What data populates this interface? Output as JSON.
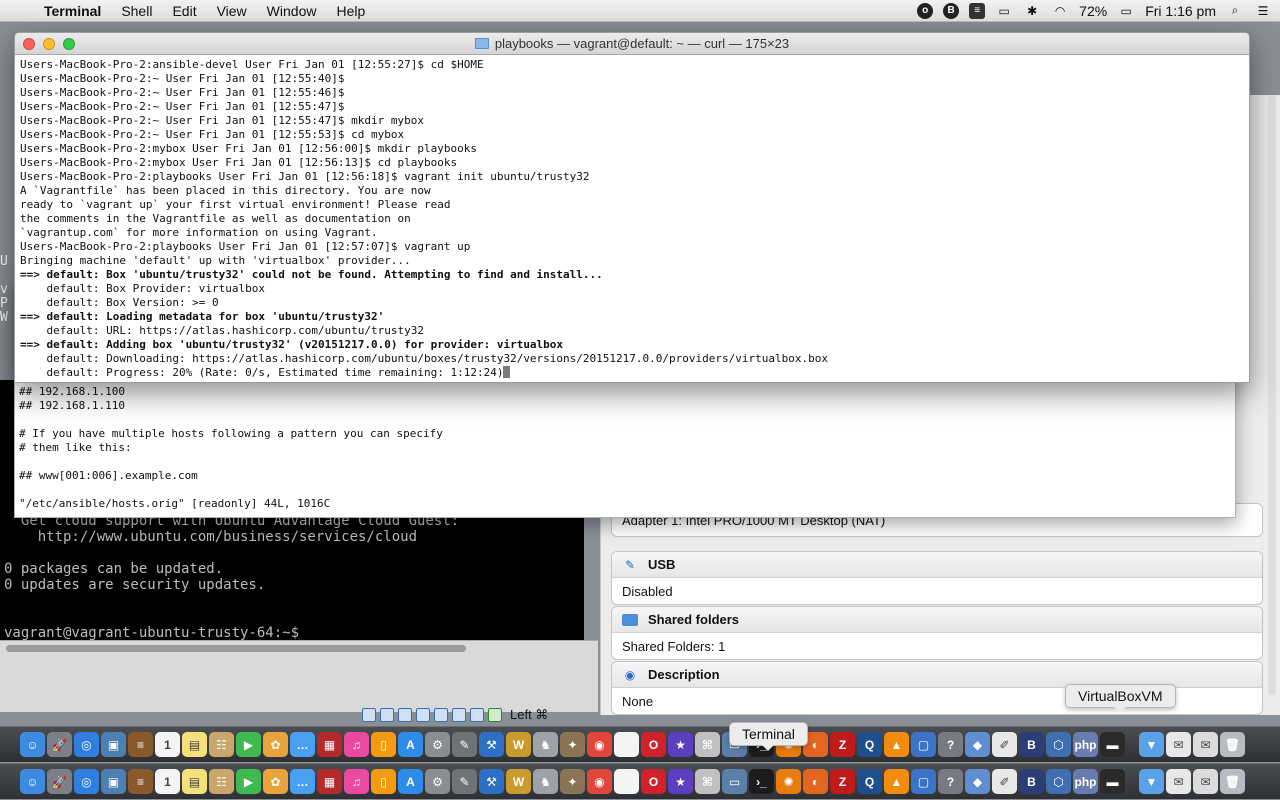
{
  "menubar": {
    "app_name": "Terminal",
    "menus": [
      "Shell",
      "Edit",
      "View",
      "Window",
      "Help"
    ],
    "battery": "72%",
    "clock": "Fri 1:16 pm"
  },
  "terminal": {
    "title": "playbooks — vagrant@default: ~ — curl — 175×23",
    "lines": [
      {
        "text": "Users-MacBook-Pro-2:ansible-devel User Fri Jan 01 [12:55:27]$ cd $HOME",
        "bold": false
      },
      {
        "text": "Users-MacBook-Pro-2:~ User Fri Jan 01 [12:55:40]$",
        "bold": false
      },
      {
        "text": "Users-MacBook-Pro-2:~ User Fri Jan 01 [12:55:46]$",
        "bold": false
      },
      {
        "text": "Users-MacBook-Pro-2:~ User Fri Jan 01 [12:55:47]$",
        "bold": false
      },
      {
        "text": "Users-MacBook-Pro-2:~ User Fri Jan 01 [12:55:47]$ mkdir mybox",
        "bold": false
      },
      {
        "text": "Users-MacBook-Pro-2:~ User Fri Jan 01 [12:55:53]$ cd mybox",
        "bold": false
      },
      {
        "text": "Users-MacBook-Pro-2:mybox User Fri Jan 01 [12:56:00]$ mkdir playbooks",
        "bold": false
      },
      {
        "text": "Users-MacBook-Pro-2:mybox User Fri Jan 01 [12:56:13]$ cd playbooks",
        "bold": false
      },
      {
        "text": "Users-MacBook-Pro-2:playbooks User Fri Jan 01 [12:56:18]$ vagrant init ubuntu/trusty32",
        "bold": false
      },
      {
        "text": "A `Vagrantfile` has been placed in this directory. You are now",
        "bold": false
      },
      {
        "text": "ready to `vagrant up` your first virtual environment! Please read",
        "bold": false
      },
      {
        "text": "the comments in the Vagrantfile as well as documentation on",
        "bold": false
      },
      {
        "text": "`vagrantup.com` for more information on using Vagrant.",
        "bold": false
      },
      {
        "text": "Users-MacBook-Pro-2:playbooks User Fri Jan 01 [12:57:07]$ vagrant up",
        "bold": false
      },
      {
        "text": "Bringing machine 'default' up with 'virtualbox' provider...",
        "bold": false
      },
      {
        "text": "==> default: Box 'ubuntu/trusty32' could not be found. Attempting to find and install...",
        "bold": true
      },
      {
        "text": "    default: Box Provider: virtualbox",
        "bold": false
      },
      {
        "text": "    default: Box Version: >= 0",
        "bold": false
      },
      {
        "text": "==> default: Loading metadata for box 'ubuntu/trusty32'",
        "bold": true
      },
      {
        "text": "    default: URL: https://atlas.hashicorp.com/ubuntu/trusty32",
        "bold": false
      },
      {
        "text": "==> default: Adding box 'ubuntu/trusty32' (v20151217.0.0) for provider: virtualbox",
        "bold": true
      },
      {
        "text": "    default: Downloading: https://atlas.hashicorp.com/ubuntu/boxes/trusty32/versions/20151217.0.0/providers/virtualbox.box",
        "bold": false
      },
      {
        "text": "    default: Progress: 20% (Rate: 0/s, Estimated time remaining: 1:12:24)",
        "bold": false
      }
    ]
  },
  "hosts_window": {
    "text": "## 192.168.1.100\n## 192.168.1.110\n\n# If you have multiple hosts following a pattern you can specify\n# them like this:\n\n## www[001:006].example.com\n\n\"/etc/ansible/hosts.orig\" [readonly] 44L, 1016C"
  },
  "vagrant_ssh": {
    "text": "  Get cloud support with Ubuntu Advantage Cloud Guest:\n    http://www.ubuntu.com/business/services/cloud\n\n0 packages can be updated.\n0 updates are security updates.\n\n\nvagrant@vagrant-ubuntu-trusty-64:~$ _",
    "host_key_label": "Left ⌘"
  },
  "vbox_details": {
    "network_value": "Adapter 1:   Intel PRO/1000 MT Desktop (NAT)",
    "usb_title": "USB",
    "usb_value": "Disabled",
    "shared_title": "Shared folders",
    "shared_value": "Shared Folders:   1",
    "desc_title": "Description",
    "desc_value": "None"
  },
  "tooltips": {
    "virtualbox": "VirtualBoxVM",
    "terminal": "Terminal"
  },
  "dock": {
    "items": [
      {
        "name": "finder-icon",
        "color": "#3d8be0",
        "glyph": "☺"
      },
      {
        "name": "launchpad-icon",
        "color": "#7a7f88",
        "glyph": "🚀"
      },
      {
        "name": "safari-icon",
        "color": "#2f7fe0",
        "glyph": "◎"
      },
      {
        "name": "preview-icon",
        "color": "#4d7fb0",
        "glyph": "▣"
      },
      {
        "name": "notes-icon",
        "color": "#8b5a2b",
        "glyph": "≡"
      },
      {
        "name": "calendar-icon",
        "color": "#f4f4f4",
        "glyph": "1"
      },
      {
        "name": "stickies-icon",
        "color": "#f5e17a",
        "glyph": "▤"
      },
      {
        "name": "contacts-icon",
        "color": "#c9a66b",
        "glyph": "☷"
      },
      {
        "name": "facetime-icon",
        "color": "#3fb950",
        "glyph": "▶"
      },
      {
        "name": "photos-icon",
        "color": "#e8a33a",
        "glyph": "✿"
      },
      {
        "name": "messages-icon",
        "color": "#4aa0f0",
        "glyph": "…"
      },
      {
        "name": "photo-booth-icon",
        "color": "#b22a2a",
        "glyph": "▦"
      },
      {
        "name": "itunes-icon",
        "color": "#e94aa0",
        "glyph": "♫"
      },
      {
        "name": "ibooks-icon",
        "color": "#f39c12",
        "glyph": "▯"
      },
      {
        "name": "app-store-icon",
        "color": "#2e8be8",
        "glyph": "A"
      },
      {
        "name": "system-preferences-icon",
        "color": "#8a8d92",
        "glyph": "⚙"
      },
      {
        "name": "script-editor-icon",
        "color": "#6f7277",
        "glyph": "✎"
      },
      {
        "name": "xcode-icon",
        "color": "#2d6fc4",
        "glyph": "⚒"
      },
      {
        "name": "textwrangler-icon",
        "color": "#c99a2e",
        "glyph": "W"
      },
      {
        "name": "chess-icon",
        "color": "#9ea2a8",
        "glyph": "♞"
      },
      {
        "name": "gimp-icon",
        "color": "#8b7355",
        "glyph": "✦"
      },
      {
        "name": "chrome-icon",
        "color": "#e0463a",
        "glyph": "◉"
      },
      {
        "name": "document-icon",
        "color": "#f4f4f4",
        "glyph": ""
      },
      {
        "name": "opera-icon",
        "color": "#d0222b",
        "glyph": "O"
      },
      {
        "name": "imovie-icon",
        "color": "#5b3fc0",
        "glyph": "★"
      },
      {
        "name": "image-capture-icon",
        "color": "#c0c0c0",
        "glyph": "⌘"
      },
      {
        "name": "scanner-icon",
        "color": "#5a7fa8",
        "glyph": "▭"
      },
      {
        "name": "terminal-icon",
        "color": "#1c1c1c",
        "glyph": "›_"
      },
      {
        "name": "blender-icon",
        "color": "#e87d0d",
        "glyph": "✺"
      },
      {
        "name": "firefox-icon",
        "color": "#e2661f",
        "glyph": "◐"
      },
      {
        "name": "filezilla-icon",
        "color": "#bf1b1b",
        "glyph": "Z"
      },
      {
        "name": "quicktime-icon",
        "color": "#1e4f8c",
        "glyph": "Q"
      },
      {
        "name": "vlc-icon",
        "color": "#f28c0f",
        "glyph": "▲"
      },
      {
        "name": "remote-desktop-icon",
        "color": "#3b73c8",
        "glyph": "▢"
      },
      {
        "name": "help-icon",
        "color": "#777a80",
        "glyph": "?"
      },
      {
        "name": "virtualbox-cube-icon",
        "color": "#5f8fd0",
        "glyph": "◆"
      },
      {
        "name": "textedit-icon",
        "color": "#e8e8e8",
        "glyph": "✐"
      },
      {
        "name": "bbedit-icon",
        "color": "#2c3e78",
        "glyph": "B"
      },
      {
        "name": "virtualbox-icon",
        "color": "#3f6fb0",
        "glyph": "⬡"
      },
      {
        "name": "php-icon",
        "color": "#6a7bb0",
        "glyph": "php"
      },
      {
        "name": "virtualboxvm-icon",
        "color": "#2a2a2a",
        "glyph": "▬"
      },
      {
        "name": "downloads-folder-icon",
        "color": "#5aa2e8",
        "glyph": "▼"
      },
      {
        "name": "mail-icon",
        "color": "#e8e8e8",
        "glyph": "✉"
      },
      {
        "name": "mail-stack-icon",
        "color": "#dcdcdc",
        "glyph": "✉"
      },
      {
        "name": "trash-icon",
        "color": "#b8bcc2",
        "glyph": "🗑"
      }
    ]
  }
}
